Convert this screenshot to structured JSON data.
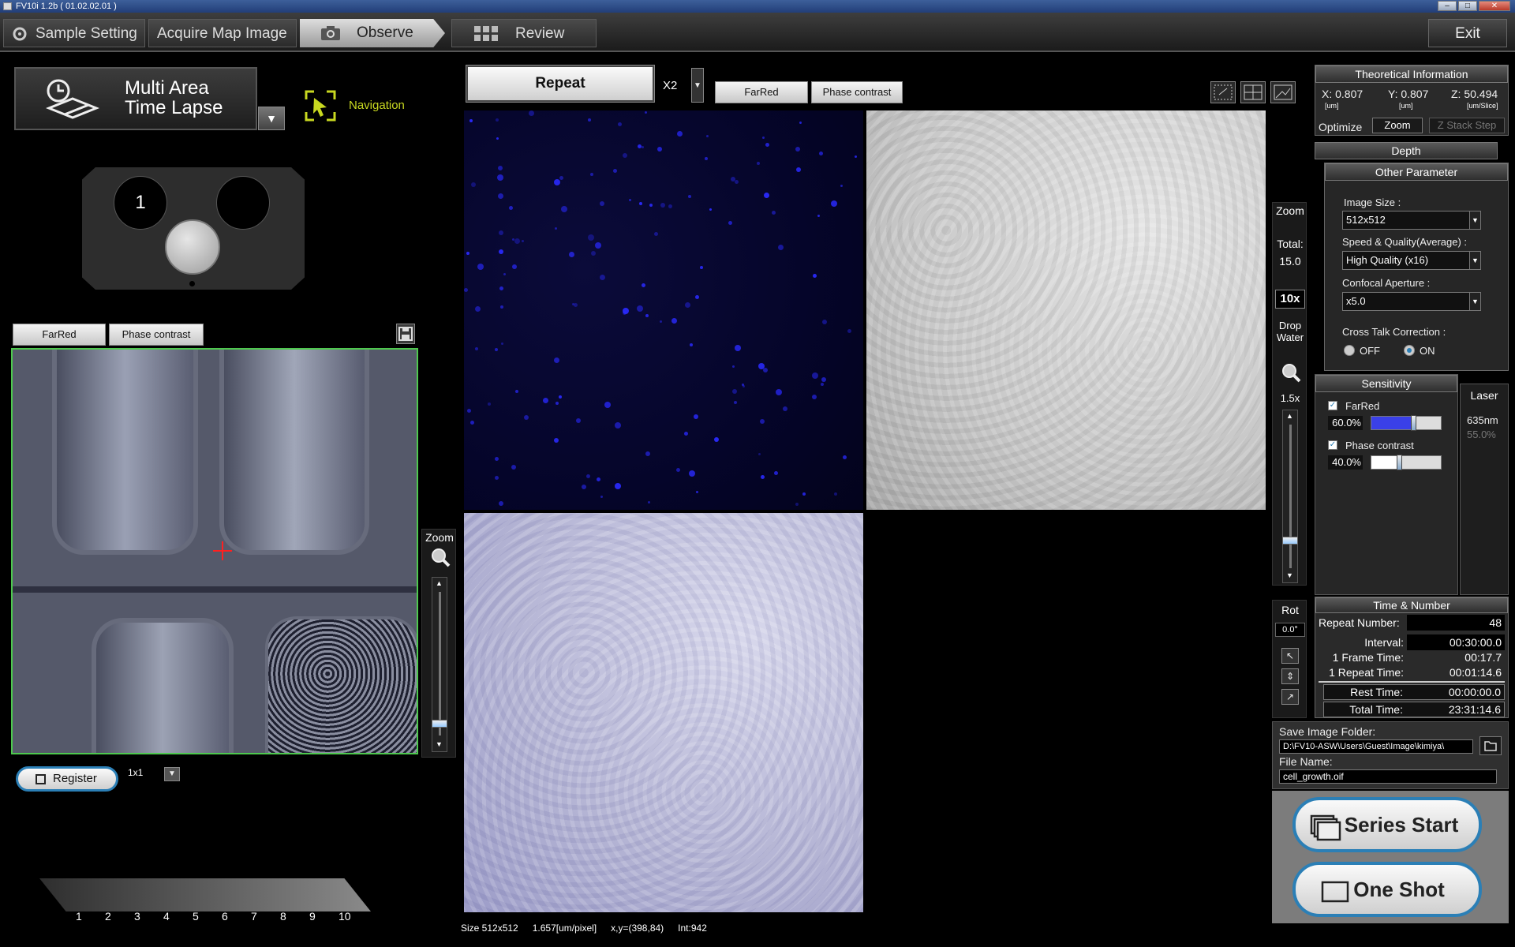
{
  "window": {
    "title": "FV10i 1.2b ( 01.02.02.01 )"
  },
  "tabs": [
    {
      "label": "Sample Setting"
    },
    {
      "label": "Acquire Map Image"
    },
    {
      "label": "Observe"
    },
    {
      "label": "Review"
    }
  ],
  "exit_label": "Exit",
  "mode": {
    "line1": "Multi Area",
    "line2": "Time Lapse"
  },
  "navigation_label": "Navigation",
  "holder": {
    "slot_label": "1"
  },
  "map": {
    "channel_tabs": [
      "FarRed",
      "Phase contrast"
    ],
    "zoom_label": "Zoom",
    "register_label": "Register",
    "grid_value": "1x1"
  },
  "scale_numbers": [
    "1",
    "2",
    "3",
    "4",
    "5",
    "6",
    "7",
    "8",
    "9",
    "10"
  ],
  "scan": {
    "mode_label": "Repeat",
    "multiplier": "X2",
    "channel_tabs": [
      "FarRed",
      "Phase contrast"
    ]
  },
  "status": {
    "size": "Size 512x512",
    "pixel": "1.657[um/pixel]",
    "xy": "x,y=(398,84)",
    "intensity": "Int:942"
  },
  "zoom_panel": {
    "title": "Zoom",
    "total_label": "Total:",
    "total_value": "15.0",
    "objective": "10x",
    "drop_water": "Drop Water",
    "zoom_value": "1.5x",
    "rot_label": "Rot",
    "rot_value": "0.0°"
  },
  "theoretical": {
    "title": "Theoretical Information",
    "x": "X: 0.807",
    "y": "Y: 0.807",
    "z": "Z: 50.494",
    "x_unit": "[um]",
    "y_unit": "[um]",
    "z_unit": "[um/Slice]",
    "optimize_label": "Optimize",
    "zoom_btn": "Zoom",
    "zstack_btn": "Z Stack Step",
    "depth_label": "Depth"
  },
  "other": {
    "title": "Other Parameter",
    "image_size_label": "Image Size :",
    "image_size": "512x512",
    "speed_label": "Speed & Quality(Average) :",
    "speed": "High Quality (x16)",
    "aperture_label": "Confocal Aperture :",
    "aperture": "x5.0",
    "crosstalk_label": "Cross Talk Correction :",
    "off_label": "OFF",
    "on_label": "ON"
  },
  "sensitivity": {
    "title": "Sensitivity",
    "laser_title": "Laser",
    "channels": [
      {
        "name": "FarRed",
        "value": "60.0%",
        "level": 0.6
      },
      {
        "name": "Phase contrast",
        "value": "40.0%",
        "level": 0.4
      }
    ],
    "laser_wavelength": "635nm",
    "laser_power": "55.0%"
  },
  "time": {
    "title": "Time & Number",
    "repeat_label": "Repeat Number:",
    "repeat_value": "48",
    "interval_label": "Interval:",
    "interval_value": "00:30:00.0",
    "frame_label": "1 Frame Time:",
    "frame_value": "00:17.7",
    "repeat_time_label": "1 Repeat Time:",
    "repeat_time_value": "00:01:14.6",
    "rest_label": "Rest Time:",
    "rest_value": "00:00:00.0",
    "total_label": "Total Time:",
    "total_value": "23:31:14.6"
  },
  "save": {
    "folder_label": "Save Image Folder:",
    "folder_value": "D:\\FV10-ASW\\Users\\Guest\\Image\\kimiya\\",
    "file_label": "File Name:",
    "file_value": "cell_growth.oif"
  },
  "buttons": {
    "series_start": "Series Start",
    "one_shot": "One Shot"
  },
  "colors": {
    "accent_blue": "#2b7fb6",
    "nav_yellow": "#c8d820",
    "map_border": "#4ec84e",
    "crosshair": "#ff2020"
  }
}
